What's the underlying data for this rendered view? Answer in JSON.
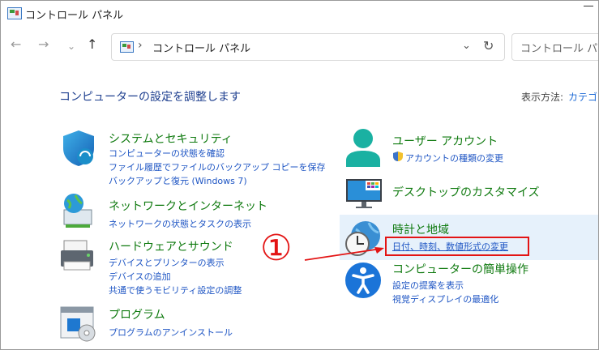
{
  "window": {
    "title": "コントロール パネル"
  },
  "nav": {
    "back": "←",
    "forward": "→",
    "recent": "⌄",
    "up": "↑",
    "breadcrumb_sep": "›",
    "address": "コントロール パネル",
    "dropdown": "⌄",
    "refresh": "↻",
    "search_placeholder": "コントロール パネル"
  },
  "header": {
    "heading": "コンピューターの設定を調整します",
    "view_by_label": "表示方法:",
    "view_by_value": "カテゴリ"
  },
  "left_categories": [
    {
      "title": "システムとセキュリティ",
      "icon": "shield-icon",
      "links": [
        "コンピューターの状態を確認",
        "ファイル履歴でファイルのバックアップ コピーを保存",
        "バックアップと復元 (Windows 7)"
      ]
    },
    {
      "title": "ネットワークとインターネット",
      "icon": "network-globe-icon",
      "links": [
        "ネットワークの状態とタスクの表示"
      ]
    },
    {
      "title": "ハードウェアとサウンド",
      "icon": "printer-icon",
      "links": [
        "デバイスとプリンターの表示",
        "デバイスの追加",
        "共通で使うモビリティ設定の調整"
      ]
    },
    {
      "title": "プログラム",
      "icon": "programs-disc-icon",
      "links": [
        "プログラムのアンインストール"
      ]
    }
  ],
  "right_categories": [
    {
      "title": "ユーザー アカウント",
      "icon": "user-icon",
      "links": [
        "アカウントの種類の変更"
      ]
    },
    {
      "title": "デスクトップのカスタマイズ",
      "icon": "monitor-icon",
      "links": []
    },
    {
      "title": "時計と地域",
      "icon": "clock-globe-icon",
      "links": [
        "日付、時刻、数値形式の変更"
      ]
    },
    {
      "title": "コンピューターの簡単操作",
      "icon": "accessibility-icon",
      "links": [
        "設定の提案を表示",
        "視覚ディスプレイの最適化"
      ]
    }
  ],
  "annotation": {
    "number": "①",
    "color": "#e31414"
  },
  "colors": {
    "category_title": "#0f7a0f",
    "link": "#1f56c4",
    "heading": "#1e3f8f",
    "highlight": "#e6f1fb"
  }
}
